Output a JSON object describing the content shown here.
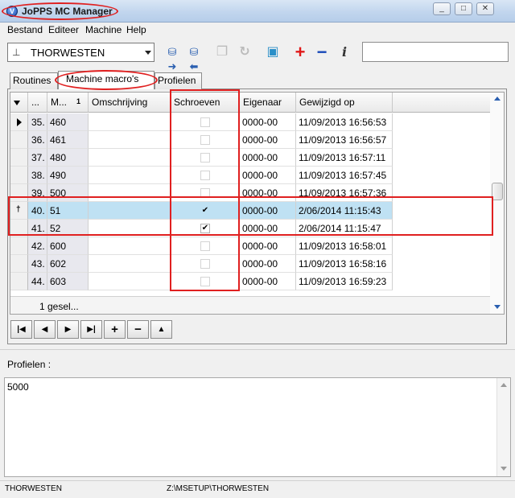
{
  "window": {
    "title": "JoPPS MC Manager",
    "icon_label": "V",
    "buttons": [
      "_",
      "□",
      "✕"
    ]
  },
  "menu": {
    "items": [
      "Bestand",
      "Editeer",
      "Machine",
      "Help"
    ]
  },
  "toolbar": {
    "machine_value": "THORWESTEN",
    "icons": [
      "import-icon",
      "export-icon",
      "copy-icon",
      "redo-icon",
      "package-icon",
      "add-icon",
      "remove-icon",
      "info-icon"
    ],
    "search_value": ""
  },
  "tabs": [
    {
      "label": "Routines",
      "active": false
    },
    {
      "label": "Machine macro's",
      "active": true
    },
    {
      "label": "Profielen",
      "active": false
    }
  ],
  "grid": {
    "columns": [
      "...",
      "M...",
      "Omschrijving",
      "Schroeven",
      "Eigenaar",
      "Gewijzigd op"
    ],
    "rows": [
      {
        "no": "35.",
        "m": "460",
        "oms": "",
        "checked": false,
        "eig": "0000-00",
        "gew": "11/09/2013 16:56:53",
        "current": true,
        "selected": false
      },
      {
        "no": "36.",
        "m": "461",
        "oms": "",
        "checked": false,
        "eig": "0000-00",
        "gew": "11/09/2013 16:56:57",
        "current": false,
        "selected": false
      },
      {
        "no": "37.",
        "m": "480",
        "oms": "",
        "checked": false,
        "eig": "0000-00",
        "gew": "11/09/2013 16:57:11",
        "current": false,
        "selected": false
      },
      {
        "no": "38.",
        "m": "490",
        "oms": "",
        "checked": false,
        "eig": "0000-00",
        "gew": "11/09/2013 16:57:45",
        "current": false,
        "selected": false
      },
      {
        "no": "39.",
        "m": "500",
        "oms": "",
        "checked": false,
        "eig": "0000-00",
        "gew": "11/09/2013 16:57:36",
        "current": false,
        "selected": false
      },
      {
        "no": "40.",
        "m": "51",
        "oms": "",
        "checked": true,
        "eig": "0000-00",
        "gew": "2/06/2014 11:15:43",
        "current": false,
        "selected": true
      },
      {
        "no": "41.",
        "m": "52",
        "oms": "",
        "checked": true,
        "eig": "0000-00",
        "gew": "2/06/2014 11:15:47",
        "current": false,
        "selected": false
      },
      {
        "no": "42.",
        "m": "600",
        "oms": "",
        "checked": false,
        "eig": "0000-00",
        "gew": "11/09/2013 16:58:01",
        "current": false,
        "selected": false
      },
      {
        "no": "43.",
        "m": "602",
        "oms": "",
        "checked": false,
        "eig": "0000-00",
        "gew": "11/09/2013 16:58:16",
        "current": false,
        "selected": false
      },
      {
        "no": "44.",
        "m": "603",
        "oms": "",
        "checked": false,
        "eig": "0000-00",
        "gew": "11/09/2013 16:59:23",
        "current": false,
        "selected": false
      }
    ],
    "footer": "1 gesel..."
  },
  "nav_buttons": [
    "|◀",
    "◀",
    "▶",
    "▶|",
    "+",
    "−",
    "▲"
  ],
  "profielen": {
    "label": "Profielen :",
    "value": "5000"
  },
  "status": {
    "left": "THORWESTEN",
    "path": "Z:\\MSETUP\\THORWESTEN"
  },
  "colors": {
    "selection": "#bfe1f3",
    "annotation_red": "#e02020",
    "accent_blue": "#2a5fb0"
  }
}
